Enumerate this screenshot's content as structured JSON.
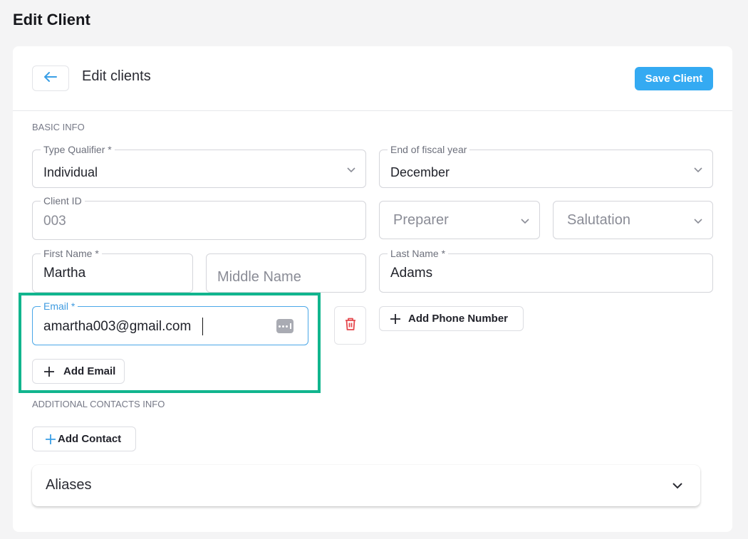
{
  "page": {
    "title": "Edit Client"
  },
  "header": {
    "title": "Edit clients",
    "save_label": "Save Client"
  },
  "basic_info": {
    "section_label": "BASIC INFO",
    "type_qualifier": {
      "label": "Type Qualifier *",
      "value": "Individual"
    },
    "fiscal_year_end": {
      "label": "End of fiscal year",
      "value": "December"
    },
    "client_id": {
      "label": "Client ID",
      "value": "003"
    },
    "preparer": {
      "placeholder": "Preparer"
    },
    "salutation": {
      "placeholder": "Salutation"
    },
    "first_name": {
      "label": "First Name *",
      "value": "Martha"
    },
    "middle_name": {
      "placeholder": "Middle Name"
    },
    "last_name": {
      "label": "Last Name *",
      "value": "Adams"
    },
    "email": {
      "label": "Email *",
      "value": "amartha003@gmail.com"
    },
    "add_email_label": "Add Email",
    "add_phone_label": "Add Phone Number"
  },
  "additional_contacts": {
    "section_label": "ADDITIONAL CONTACTS INFO",
    "add_contact_label": "Add Contact"
  },
  "aliases": {
    "label": "Aliases"
  },
  "colors": {
    "accent": "#34aaf2",
    "highlight": "#11b58e",
    "delete": "#e5484d"
  },
  "icons": [
    "arrow-left-icon",
    "chevron-down-icon",
    "trash-icon",
    "plus-icon",
    "password-manager-icon"
  ]
}
